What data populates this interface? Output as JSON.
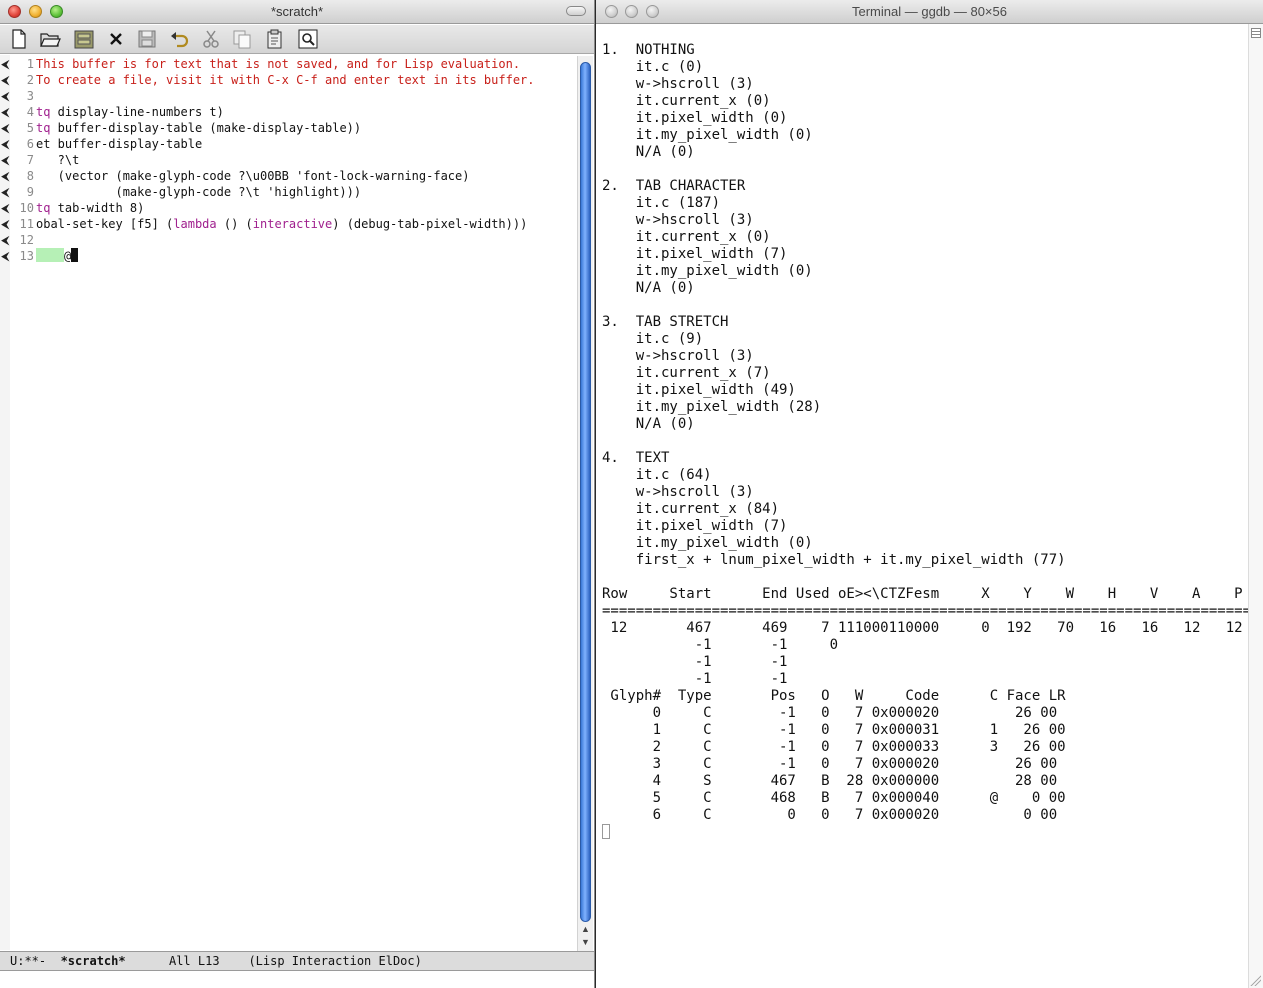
{
  "emacs": {
    "title": "*scratch*",
    "toolbar": [
      {
        "name": "new-file-icon"
      },
      {
        "name": "open-folder-icon"
      },
      {
        "name": "dired-icon"
      },
      {
        "name": "close-icon"
      },
      {
        "name": "save-icon"
      },
      {
        "name": "undo-icon"
      },
      {
        "name": "cut-icon"
      },
      {
        "name": "copy-icon"
      },
      {
        "name": "paste-icon"
      },
      {
        "name": "search-icon"
      }
    ],
    "lines": [
      {
        "num": "1",
        "segments": [
          {
            "text": "This buffer is for text that is not saved, and for Lisp evaluation.",
            "style": "red"
          }
        ]
      },
      {
        "num": "2",
        "segments": [
          {
            "text": "To create a file, visit it with C-x C-f and enter text in its buffer.",
            "style": "red"
          }
        ]
      },
      {
        "num": "3",
        "segments": []
      },
      {
        "num": "4",
        "segments": [
          {
            "text": "tq",
            "style": "kw"
          },
          {
            "text": " display-line-numbers t)",
            "style": ""
          }
        ]
      },
      {
        "num": "5",
        "segments": [
          {
            "text": "tq",
            "style": "kw"
          },
          {
            "text": " buffer-display-table (make-display-table))",
            "style": ""
          }
        ]
      },
      {
        "num": "6",
        "segments": [
          {
            "text": "et buffer-display-table",
            "style": ""
          }
        ]
      },
      {
        "num": "7",
        "segments": [
          {
            "text": "   ?\\t",
            "style": ""
          }
        ]
      },
      {
        "num": "8",
        "segments": [
          {
            "text": "   (vector (make-glyph-code ?\\u00BB 'font-lock-warning-face)",
            "style": ""
          }
        ]
      },
      {
        "num": "9",
        "segments": [
          {
            "text": "           (make-glyph-code ?\\t 'highlight)))",
            "style": ""
          }
        ]
      },
      {
        "num": "10",
        "segments": [
          {
            "text": "tq",
            "style": "kw"
          },
          {
            "text": " tab-width 8)",
            "style": ""
          }
        ]
      },
      {
        "num": "11",
        "segments": [
          {
            "text": "obal-set-key [f5] (",
            "style": ""
          },
          {
            "text": "lambda",
            "style": "kw"
          },
          {
            "text": " () (",
            "style": ""
          },
          {
            "text": "interactive",
            "style": "kw"
          },
          {
            "text": ") (debug-tab-pixel-width)))",
            "style": ""
          }
        ]
      },
      {
        "num": "12",
        "segments": []
      },
      {
        "num": "13",
        "segments": [
          {
            "text": "",
            "style": "tabhl"
          },
          {
            "text": "@",
            "style": ""
          },
          {
            "text": "",
            "style": "cursor"
          }
        ]
      }
    ],
    "modeline": {
      "status": "U:**-",
      "buffer": "*scratch*",
      "position": "All L13",
      "modes": "(Lisp Interaction ElDoc)"
    }
  },
  "terminal": {
    "title": "Terminal — ggdb — 80×56",
    "lines": [
      "1.  NOTHING",
      "    it.c (0)",
      "    w->hscroll (3)",
      "    it.current_x (0)",
      "    it.pixel_width (0)",
      "    it.my_pixel_width (0)",
      "    N/A (0)",
      "",
      "2.  TAB CHARACTER",
      "    it.c (187)",
      "    w->hscroll (3)",
      "    it.current_x (0)",
      "    it.pixel_width (7)",
      "    it.my_pixel_width (0)",
      "    N/A (0)",
      "",
      "3.  TAB STRETCH",
      "    it.c (9)",
      "    w->hscroll (3)",
      "    it.current_x (7)",
      "    it.pixel_width (49)",
      "    it.my_pixel_width (28)",
      "    N/A (0)",
      "",
      "4.  TEXT",
      "    it.c (64)",
      "    w->hscroll (3)",
      "    it.current_x (84)",
      "    it.pixel_width (7)",
      "    it.my_pixel_width (0)",
      "    first_x + lnum_pixel_width + it.my_pixel_width (77)",
      "",
      "Row     Start      End Used oE><\\CTZFesm     X    Y    W    H    V    A    P",
      "==============================================================================",
      " 12       467      469    7 111000110000     0  192   70   16   16   12   12",
      "           -1       -1     0",
      "           -1       -1",
      "           -1       -1",
      " Glyph#  Type       Pos   O   W     Code      C Face LR",
      "      0     C        -1   0   7 0x000020         26 00",
      "      1     C        -1   0   7 0x000031      1   26 00",
      "      2     C        -1   0   7 0x000033      3   26 00",
      "      3     C        -1   0   7 0x000020         26 00",
      "      4     S       467   B  28 0x000000         28 00",
      "      5     C       468   B   7 0x000040      @    0 00",
      "      6     C         0   0   7 0x000020          0 00"
    ]
  }
}
